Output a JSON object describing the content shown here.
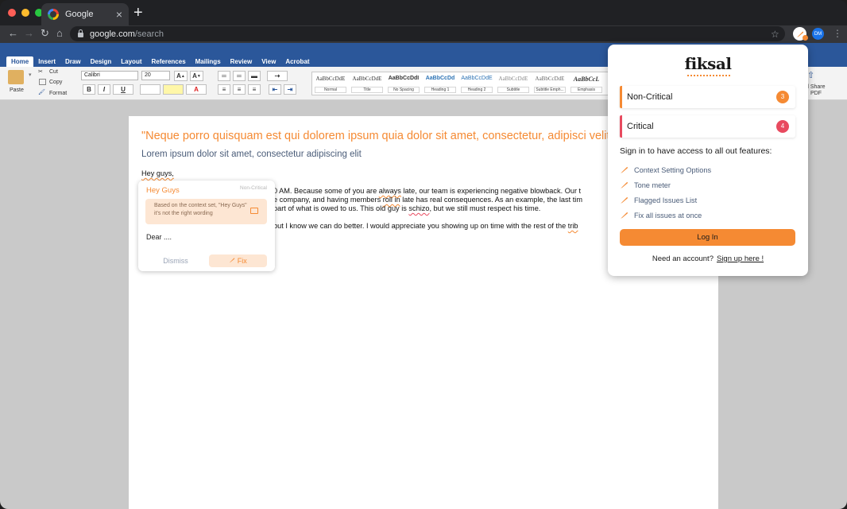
{
  "browser": {
    "tab_title": "Google",
    "new_tab": "+",
    "tab_close": "×",
    "url_host": "google.com",
    "url_path": "/search",
    "avatar_initials": "DM",
    "traffic": [
      "#ff5f57",
      "#febc2e",
      "#28c840"
    ]
  },
  "ribbon": {
    "tabs": [
      "Home",
      "Insert",
      "Draw",
      "Design",
      "Layout",
      "References",
      "Mailings",
      "Review",
      "View",
      "Acrobat"
    ],
    "active_tab": "Home",
    "paste_label": "Paste",
    "cut_label": "Cut",
    "copy_label": "Copy",
    "format_label": "Format",
    "font_name": "Calibri",
    "font_size": "20",
    "bold": "B",
    "italic": "I",
    "underline": "U",
    "styles": [
      {
        "sample": "AaBbCcDdE",
        "name": "Normal"
      },
      {
        "sample": "AaBbCcDdE",
        "name": "Title"
      },
      {
        "sample": "AaBbCcDdI",
        "name": "No Spacing"
      },
      {
        "sample": "AaBbCcDd",
        "name": "Heading 1"
      },
      {
        "sample": "AaBbCcDdE",
        "name": "Heading 2"
      },
      {
        "sample": "AaBbCcDdE",
        "name": "Subtitle"
      },
      {
        "sample": "AaBbCcDdE",
        "name": "Subtitle Emph..."
      },
      {
        "sample": "AaBbCcL",
        "name": "Emphasis"
      }
    ],
    "share_label_1": "d Share",
    "share_label_2": "PDF"
  },
  "document": {
    "title": "\"Neque porro quisquam est qui dolorem ipsum quia dolor sit amet, consectetur, adipisci velit\"",
    "subtitle": "Lorem ipsum dolor sit amet, consectetur adipiscing elit",
    "greeting": "Hey guys,",
    "line1_a": "0 AM. Because some of you are ",
    "line1_flag": "always",
    "line1_b": " late, our team is experiencing negative blowback. Our t",
    "line2_a": "e company, and having members ",
    "line2_flag": "roll in",
    "line2_b": " late has real consequences. As an example, the last tim",
    "line3_a": "part of what is owed to us. This old guy is ",
    "line3_flag": "schizo",
    "line3_b": ", but we still must respect his time.",
    "line4_a": "but I know we can do better. I would appreciate you showing up on time with the rest of the ",
    "line4_flag": "trib"
  },
  "suggestion": {
    "title": "Hey Guys",
    "severity": "Non-Critical",
    "reason": "Based on the context set, \"Hey Guys\" it's not the right wording",
    "replacement": "Dear ....",
    "dismiss_label": "Dismiss",
    "fix_label": "Fix"
  },
  "fiksal": {
    "logo": "fiksal",
    "non_critical_label": "Non-Critical",
    "non_critical_count": "3",
    "critical_label": "Critical",
    "critical_count": "4",
    "signin_heading": "Sign in to have access to all out features:",
    "features": [
      "Context Setting Options",
      "Tone meter",
      "Flagged Issues List",
      "Fix all issues at once"
    ],
    "login_label": "Log In",
    "need_account": "Need an account?",
    "signup_label": "Sign up here !",
    "colors": {
      "orange": "#f58a33",
      "red": "#e84a5f"
    }
  }
}
